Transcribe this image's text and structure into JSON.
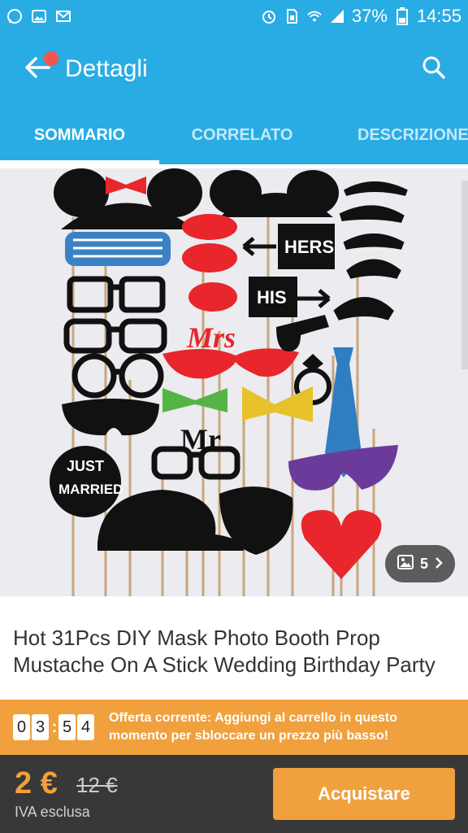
{
  "status_bar": {
    "battery": "37%",
    "time": "14:55",
    "icons": [
      "whatsapp-icon",
      "gallery-icon",
      "gmail-icon",
      "alarm-icon",
      "sim-icon",
      "wifi-icon",
      "signal-icon",
      "battery-icon"
    ]
  },
  "toolbar": {
    "title": "Dettagli",
    "back_icon": "arrow-left-icon",
    "search_icon": "search-icon"
  },
  "tabs": [
    {
      "label": "SOMMARIO",
      "active": true
    },
    {
      "label": "CORRELATO",
      "active": false
    },
    {
      "label": "DESCRIZIONE",
      "active": false
    }
  ],
  "gallery": {
    "count": "5",
    "props_text": {
      "hers": "HERS",
      "his": "HIS",
      "mrs": "Mrs",
      "mr": "Mr",
      "just": "JUST",
      "married": "MARRIED"
    }
  },
  "product": {
    "title": "Hot 31Pcs DIY Mask Photo Booth Prop Mustache On A Stick Wedding Birthday Party"
  },
  "offer": {
    "timer_digits": [
      "0",
      "3",
      "5",
      "4"
    ],
    "text": "Offerta corrente: Aggiungi al carrello in questo momento per sbloccare un prezzo più basso!"
  },
  "purchase": {
    "price": "2 €",
    "old_price": "12 €",
    "vat_note": "IVA esclusa",
    "buy_label": "Acquistare"
  },
  "colors": {
    "primary": "#29ace4",
    "accent": "#f0a03d",
    "bottom_bar": "#383838",
    "notification": "#f2554f"
  }
}
